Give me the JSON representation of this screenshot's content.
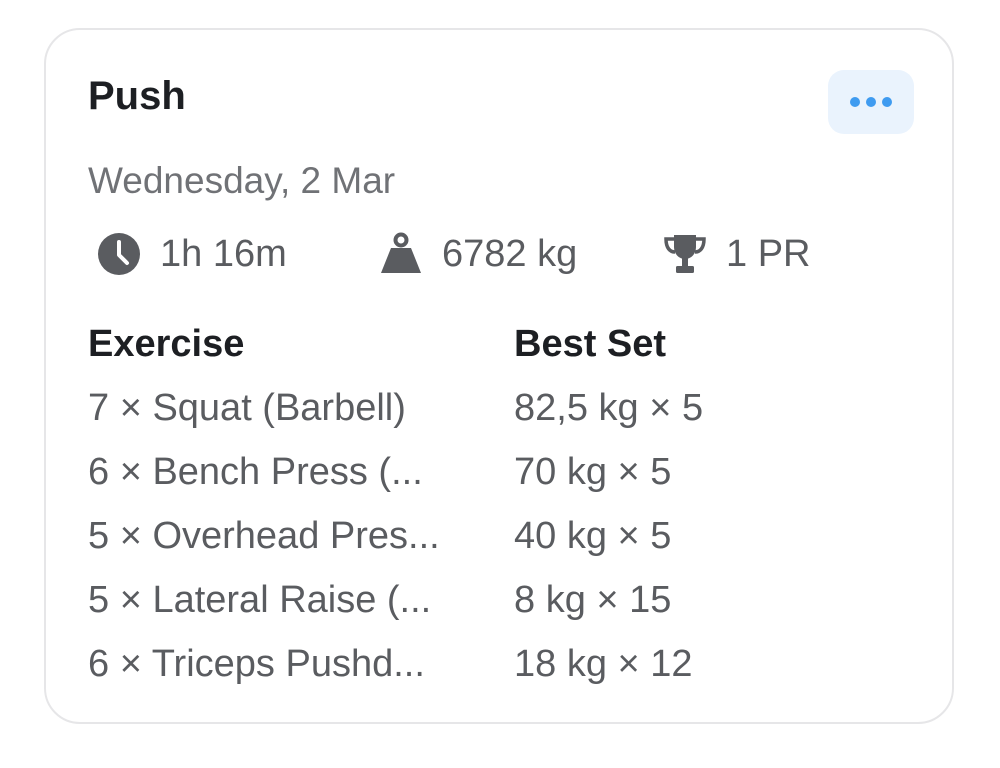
{
  "workout": {
    "title": "Push",
    "date": "Wednesday, 2 Mar",
    "more_icon": "more-horizontal-icon",
    "accent_color": "#3f9bf0",
    "stats": {
      "duration": {
        "icon": "clock-icon",
        "value": "1h 16m"
      },
      "volume": {
        "icon": "weight-icon",
        "value": "6782 kg"
      },
      "records": {
        "icon": "trophy-icon",
        "value": "1 PR"
      }
    },
    "table": {
      "headers": {
        "exercise": "Exercise",
        "best_set": "Best Set"
      },
      "rows": [
        {
          "exercise": "7 × Squat (Barbell)",
          "best_set": "82,5 kg × 5"
        },
        {
          "exercise": "6 × Bench Press (...",
          "best_set": "70 kg × 5"
        },
        {
          "exercise": "5 × Overhead Pres...",
          "best_set": "40 kg × 5"
        },
        {
          "exercise": "5 × Lateral Raise (...",
          "best_set": "8 kg × 15"
        },
        {
          "exercise": "6 × Triceps Pushd...",
          "best_set": "18 kg × 12"
        }
      ]
    }
  }
}
